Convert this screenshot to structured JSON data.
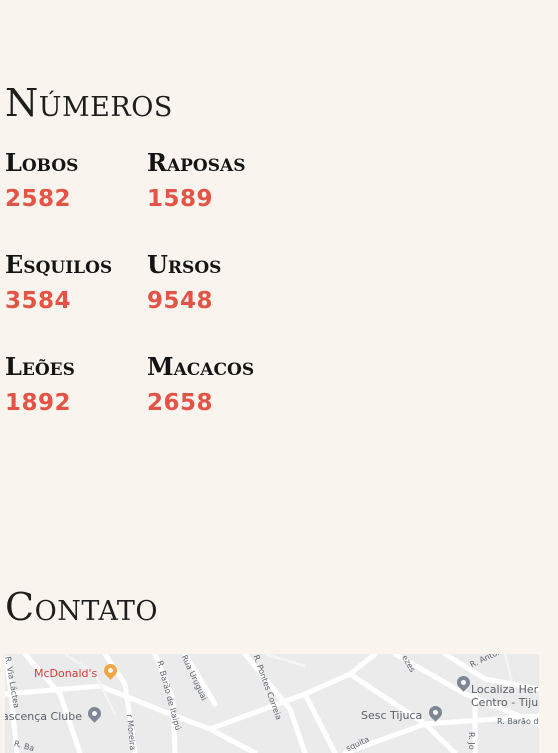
{
  "numeros": {
    "title": "Números",
    "stats": [
      {
        "label": "Lobos",
        "value": "2582"
      },
      {
        "label": "Raposas",
        "value": "1589"
      },
      {
        "label": "Esquilos",
        "value": "3584"
      },
      {
        "label": "Ursos",
        "value": "9548"
      },
      {
        "label": "Leões",
        "value": "1892"
      },
      {
        "label": "Macacos",
        "value": "2658"
      }
    ]
  },
  "contato": {
    "title": "Contato",
    "map": {
      "places": [
        {
          "name": "McDonald's",
          "icon": "restaurant-pin-icon"
        },
        {
          "name": "ascença Clube",
          "icon": "place-pin-icon"
        },
        {
          "name": "Sesc Tijuca",
          "icon": "place-pin-icon"
        },
        {
          "name": "Localiza Her",
          "icon": "place-pin-icon"
        },
        {
          "name": "Centro - Tiju",
          "icon": ""
        }
      ],
      "streets": [
        "R. Via Láctea",
        "R. Barão de Itaipú",
        "Rua Uruguai",
        "R. Pontes Correia",
        "R. Antôn",
        "R. Barão de",
        "r Moreira",
        "R. Ba",
        "R. Jo",
        "ezes",
        "squita"
      ]
    }
  }
}
